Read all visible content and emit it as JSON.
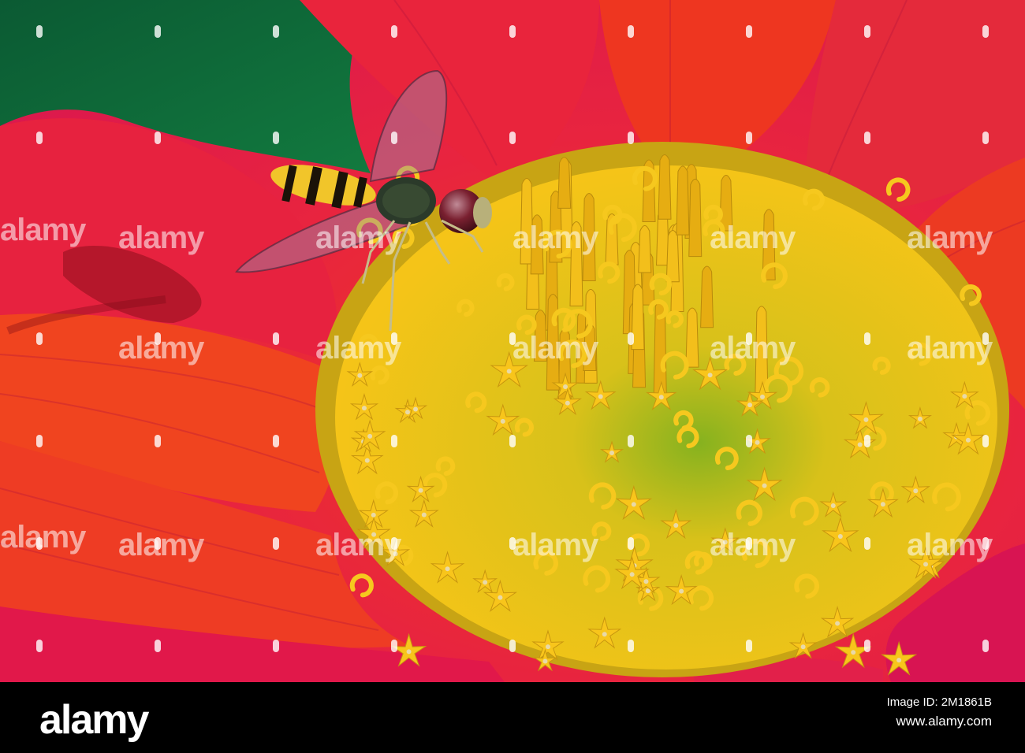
{
  "watermark": {
    "text": "alamy"
  },
  "footer": {
    "logo": "alamy",
    "image_id_label": "Image ID: 2M1861B",
    "image_id": "2M1861B",
    "url": "www.alamy.com"
  },
  "colors": {
    "petal": "#e8233e",
    "petal_orange": "#f0471e",
    "disc": "#f5c418",
    "background_green": "#0f6a3a"
  }
}
